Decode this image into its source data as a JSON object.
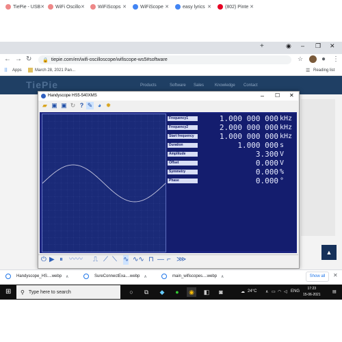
{
  "browser": {
    "tabs": [
      {
        "label": "TiePie - USB"
      },
      {
        "label": "WiFi Oscillo"
      },
      {
        "label": "WiFiScops"
      },
      {
        "label": "WiFiScope"
      },
      {
        "label": "easy lyrics"
      },
      {
        "label": "(802) Pinte"
      }
    ],
    "new_tab": "+",
    "url": "tiepie.com/en/wifi-oscilloscope/wifiscope-ws5#software",
    "bookmarks": {
      "apps": "Apps",
      "item": "March 28, 2021 Pan...",
      "reading_list": "Reading list"
    }
  },
  "website": {
    "logo": "TiePie",
    "nav": [
      "Products",
      "Software",
      "Sales",
      "Knowledge",
      "Contact"
    ]
  },
  "app": {
    "title": "Handyscope HS5-540XMS",
    "params": [
      {
        "label": "Frequency1",
        "value": "1.000 000 000",
        "unit": "kHz"
      },
      {
        "label": "Frequency2",
        "value": "2.000 000 000",
        "unit": "kHz"
      },
      {
        "label": "Start frequency",
        "value": "1.000 000 000",
        "unit": "kHz"
      },
      {
        "label": "Duration",
        "value": "1.000 000",
        "unit": "s"
      },
      {
        "label": "Amplitude",
        "value": "3.300",
        "unit": "V"
      },
      {
        "label": "Offset",
        "value": "0.000",
        "unit": "V"
      },
      {
        "label": "Symmetry",
        "value": "0.000",
        "unit": "%"
      },
      {
        "label": "Phase",
        "value": "0.000",
        "unit": "°"
      }
    ]
  },
  "downloads": {
    "items": [
      {
        "name": "Handyscope_HS....webp"
      },
      {
        "name": "SureConnectExa....webp"
      },
      {
        "name": "main_wifiscopes....webp"
      }
    ],
    "show_all": "Show all"
  },
  "taskbar": {
    "search_placeholder": "Type here to search",
    "temp": "24°C",
    "lang": "ENG",
    "time": "17:23",
    "date": "15-06-2021"
  },
  "colors": {
    "app_bg": "#1a237e",
    "waveform": "#c8c8e0",
    "site_header": "#1f3f64"
  }
}
